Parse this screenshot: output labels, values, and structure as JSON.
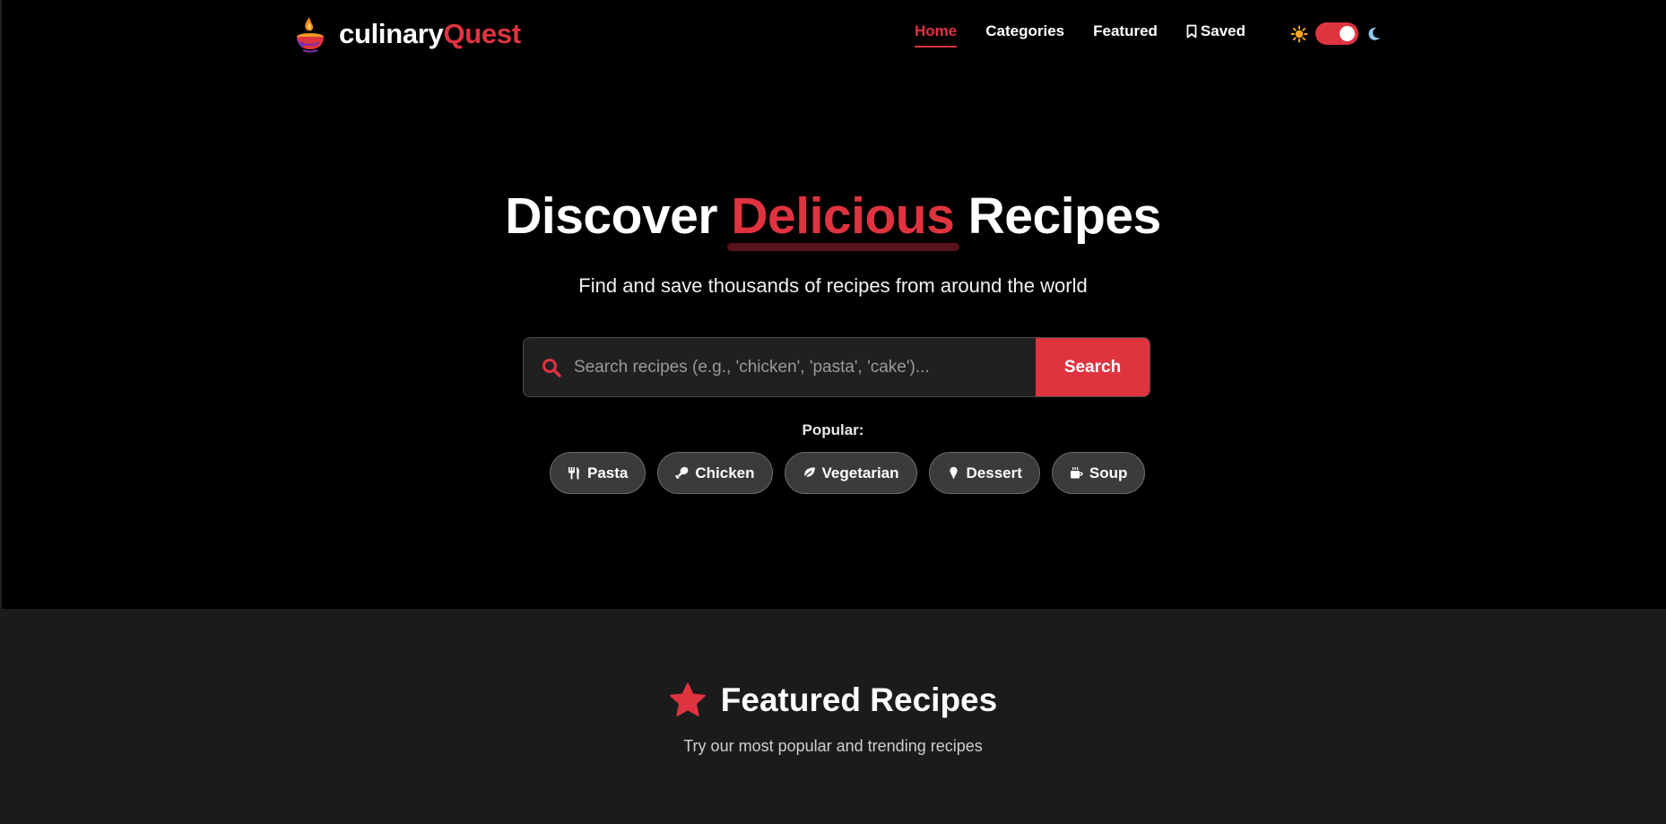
{
  "brand": {
    "name_part1": "culinary",
    "name_part2": "Quest",
    "logo_icon": "flame-bowl-logo"
  },
  "nav": {
    "items": [
      {
        "label": "Home",
        "active": true
      },
      {
        "label": "Categories",
        "active": false
      },
      {
        "label": "Featured",
        "active": false
      },
      {
        "label": "Saved",
        "active": false,
        "icon": "bookmark-icon"
      }
    ]
  },
  "theme_toggle": {
    "left_icon": "sun-icon",
    "right_icon": "moon-icon",
    "state": "on"
  },
  "hero": {
    "title_before": "Discover",
    "title_highlight": "Delicious",
    "title_after": "Recipes",
    "subtitle": "Find and save thousands of recipes from around the world"
  },
  "search": {
    "placeholder": "Search recipes (e.g., 'chicken', 'pasta', 'cake')...",
    "value": "",
    "button_label": "Search",
    "icon": "search-icon"
  },
  "popular": {
    "label": "Popular:",
    "chips": [
      {
        "label": "Pasta",
        "icon": "utensils-icon"
      },
      {
        "label": "Chicken",
        "icon": "drumstick-icon"
      },
      {
        "label": "Vegetarian",
        "icon": "leaf-icon"
      },
      {
        "label": "Dessert",
        "icon": "ice-cream-icon"
      },
      {
        "label": "Soup",
        "icon": "mug-icon"
      }
    ]
  },
  "featured": {
    "title": "Featured Recipes",
    "icon": "star-icon",
    "subtitle": "Try our most popular and trending recipes"
  },
  "colors": {
    "accent": "#e03340",
    "background": "#000000",
    "section_bg": "#1b1b1b",
    "chip_bg": "#3b3b3b"
  }
}
